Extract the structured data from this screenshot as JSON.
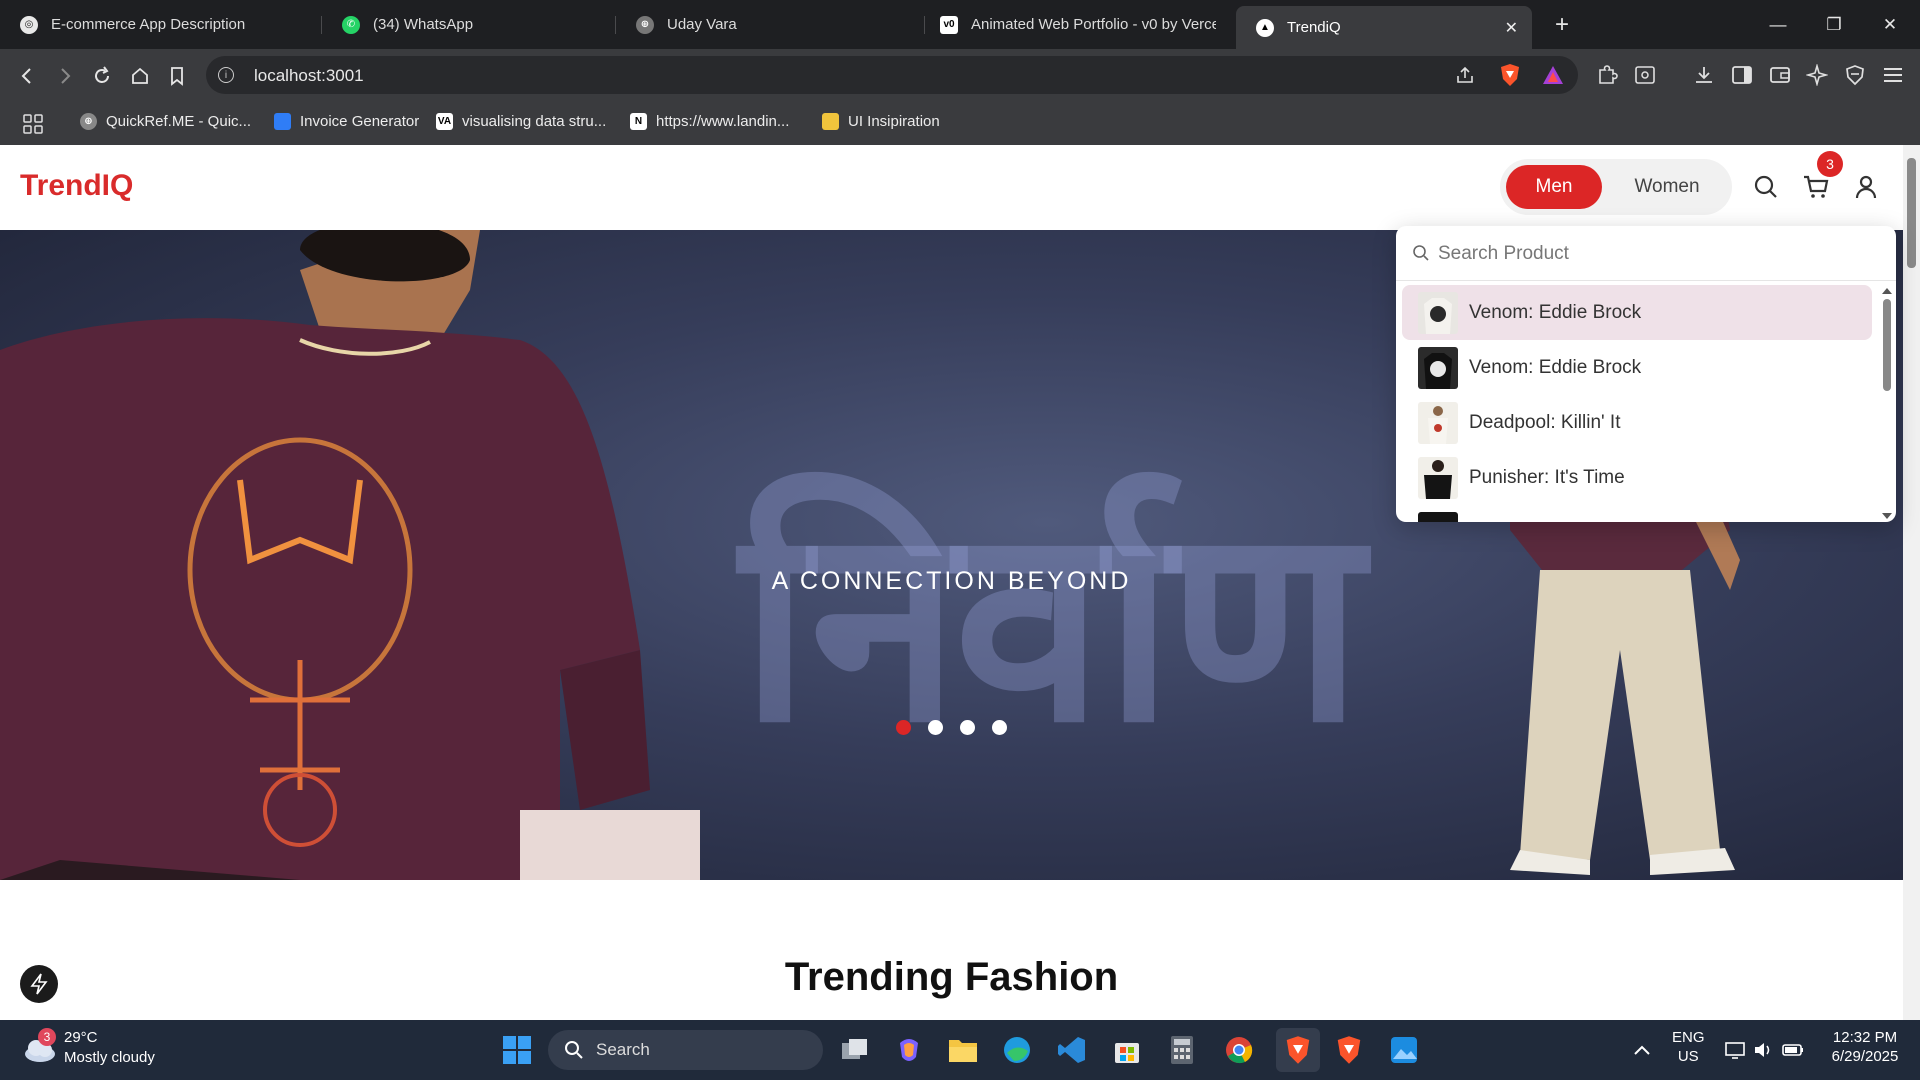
{
  "browser": {
    "tabs": [
      {
        "title": "E-commerce App Description",
        "active": false
      },
      {
        "title": "(34) WhatsApp",
        "active": false
      },
      {
        "title": "Uday Vara",
        "active": false
      },
      {
        "title": "Animated Web Portfolio - v0 by Vercel",
        "active": false
      },
      {
        "title": "TrendiQ",
        "active": true
      }
    ],
    "url": "localhost:3001",
    "bookmarks": [
      {
        "label": "QuickRef.ME - Quic..."
      },
      {
        "label": "Invoice Generator"
      },
      {
        "label": "visualising data stru..."
      },
      {
        "label": "https://www.landin..."
      },
      {
        "label": "UI Insipiration"
      }
    ]
  },
  "site": {
    "logo": "TrendIQ",
    "gender_toggle": {
      "men": "Men",
      "women": "Women",
      "selected": "Men"
    },
    "cart_count": "3",
    "search": {
      "placeholder": "Search Product",
      "value": "",
      "results": [
        {
          "name": "Venom: Eddie Brock",
          "highlighted": true
        },
        {
          "name": "Venom: Eddie Brock",
          "highlighted": false
        },
        {
          "name": "Deadpool: Killin' It",
          "highlighted": false
        },
        {
          "name": "Punisher: It's Time",
          "highlighted": false
        }
      ]
    },
    "hero": {
      "word": "निर्वाण",
      "tagline": "A CONNECTION BEYOND",
      "slides": 4,
      "active_slide": 1
    },
    "section_title": "Trending Fashion",
    "accent_color": "#dc2626"
  },
  "taskbar": {
    "weather": {
      "badge": "3",
      "temp": "29°C",
      "condition": "Mostly cloudy"
    },
    "search_label": "Search",
    "lang": {
      "line1": "ENG",
      "line2": "US"
    },
    "clock": {
      "time": "12:32 PM",
      "date": "6/29/2025"
    }
  }
}
